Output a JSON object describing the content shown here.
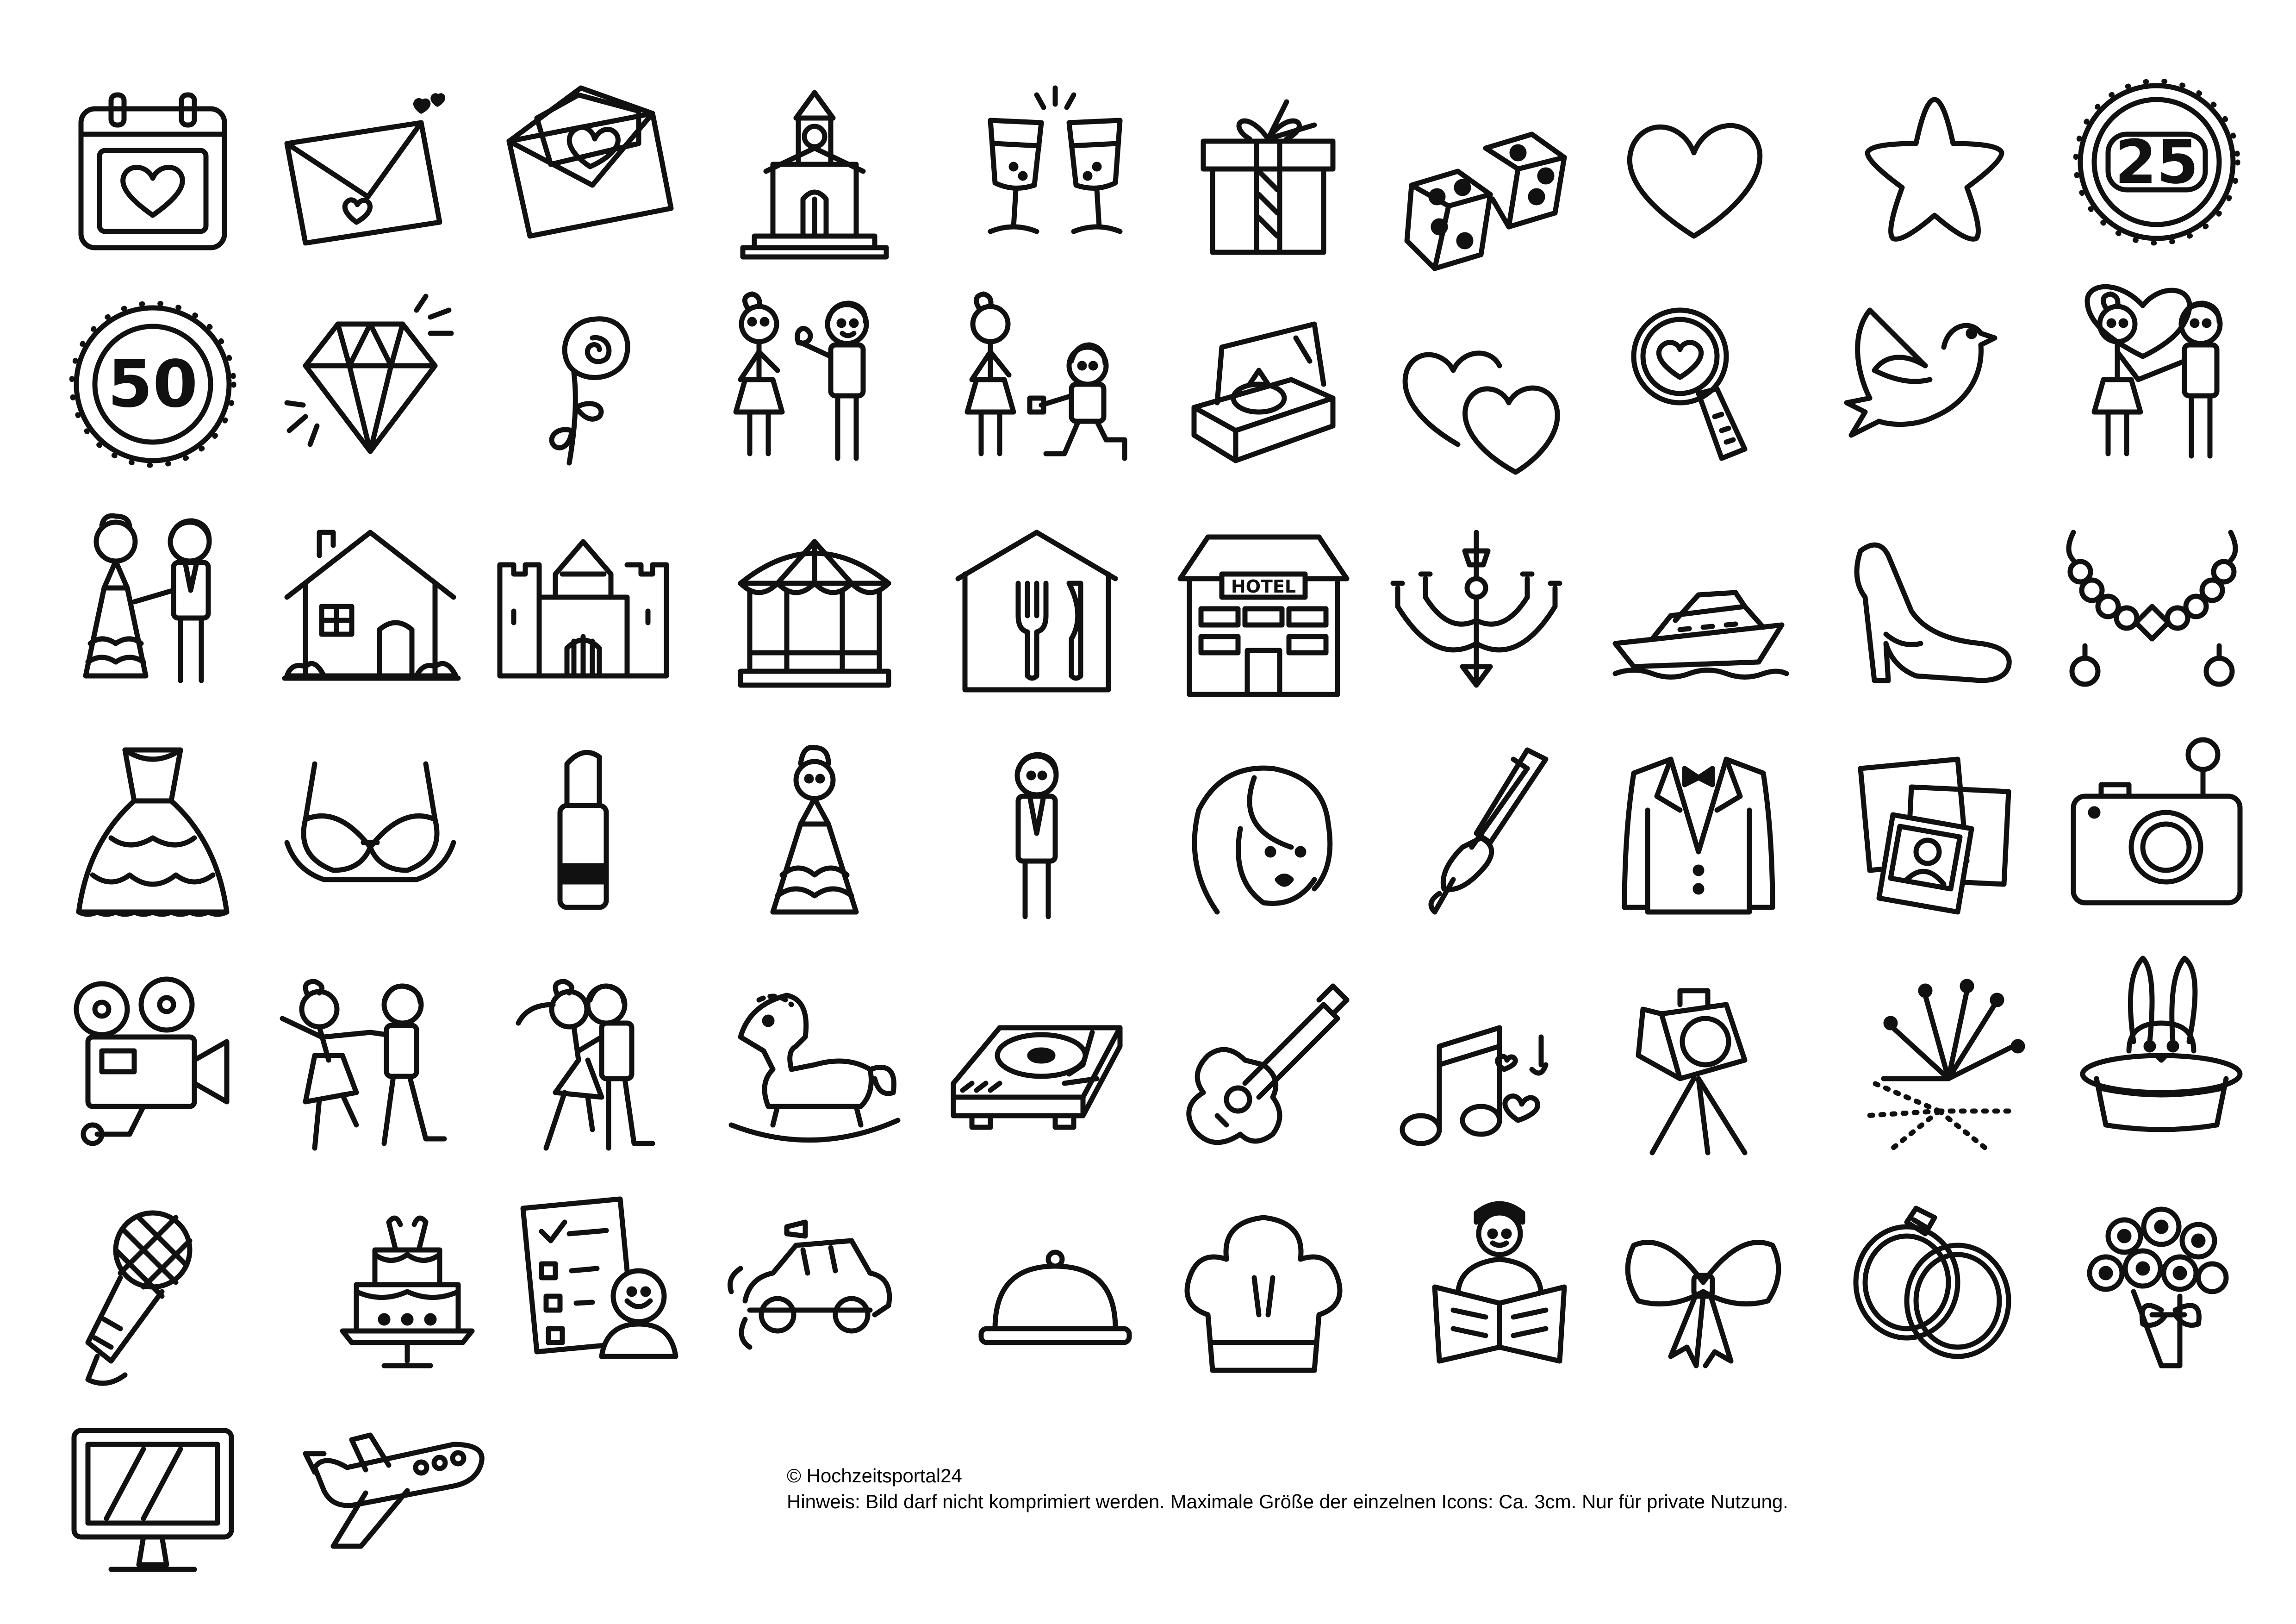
{
  "badges": {
    "anniversary_25": "25",
    "anniversary_50": "50",
    "hotel_sign": "HOTEL"
  },
  "footer": {
    "copyright": "© Hochzeitsportal24",
    "notice": "Hinweis: Bild darf nicht komprimiert werden. Maximale Größe der einzelnen Icons: Ca. 3cm. Nur für private Nutzung."
  },
  "icons": [
    "calendar-heart-icon",
    "love-letter-icon",
    "open-envelope-heart-icon",
    "chapel-icon",
    "champagne-toast-icon",
    "gift-box-icon",
    "dice-icon",
    "heart-icon",
    "star-icon",
    "badge-25-icon",
    "badge-50-icon",
    "diamond-icon",
    "rose-icon",
    "couple-rose-icon",
    "proposal-icon",
    "ring-box-icon",
    "two-hearts-icon",
    "magnifier-heart-icon",
    "dove-icon",
    "couple-holding-hands-icon",
    "bride-groom-icon",
    "house-icon",
    "castle-icon",
    "pavilion-icon",
    "restaurant-icon",
    "hotel-icon",
    "chandelier-icon",
    "yacht-icon",
    "high-heel-icon",
    "necklace-earrings-icon",
    "wedding-dress-icon",
    "bra-icon",
    "lipstick-icon",
    "bride-icon",
    "groom-icon",
    "woman-face-icon",
    "curling-iron-icon",
    "tuxedo-jacket-icon",
    "photos-icon",
    "camera-icon",
    "video-camera-icon",
    "dancing-couple-icon",
    "kissing-couple-icon",
    "rocking-horse-icon",
    "turntable-icon",
    "guitar-icon",
    "music-notes-icon",
    "spotlight-icon",
    "fireworks-icon",
    "magic-hat-rabbit-icon",
    "microphone-icon",
    "wedding-cake-icon",
    "checklist-person-icon",
    "wedding-car-icon",
    "cloche-icon",
    "chef-hat-icon",
    "officiant-icon",
    "bow-icon",
    "wedding-rings-icon",
    "bouquet-icon",
    "monitor-icon",
    "airplane-icon"
  ]
}
